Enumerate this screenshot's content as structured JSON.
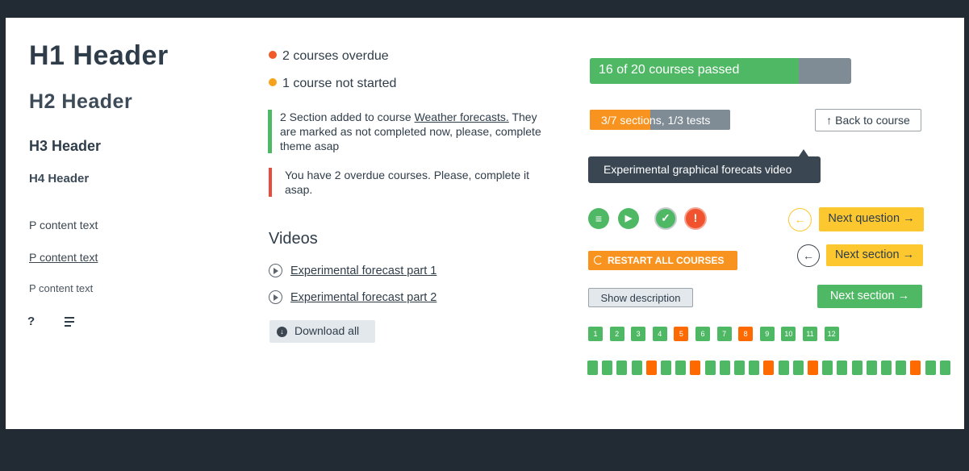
{
  "colors": {
    "green": "#4fb865",
    "orange": "#f7931e",
    "red_orange": "#ff6a00",
    "red": "#e94b3c",
    "yellow": "#fdc82f",
    "dark": "#3a4753",
    "gray": "#7f8c95"
  },
  "typography": {
    "h1": "H1 Header",
    "h2": "H2  Header",
    "h3": "H3  Header",
    "h4": "H4  Header",
    "p_plain": "P content text",
    "p_link": "P content text",
    "p_small": "P content text",
    "help_icon_glyph": "?",
    "icons": [
      "help-icon",
      "menu-icon"
    ]
  },
  "status": {
    "overdue": "2 courses overdue",
    "not_started": "1 course not started",
    "overdue_color": "#f15a29",
    "not_started_color": "#f7a21b"
  },
  "notices": [
    {
      "text_before": "2 Section added to course ",
      "link": "Weather forecasts.",
      "text_after": " They are marked as not completed now, please, complete theme asap",
      "color": "#4fb865"
    },
    {
      "text": "You have 2 overdue courses. Please, complete it asap.",
      "color": "#e94b3c"
    }
  ],
  "videos": {
    "title": "Videos",
    "items": [
      "Experimental forecast part 1",
      "Experimental forecast part 2"
    ],
    "download_label": "Download all"
  },
  "progress": {
    "courses_label": "16 of 20 courses passed",
    "courses_passed": 16,
    "courses_total": 20,
    "sections_label": "3/7 sections, 1/3 tests",
    "sections_done": 3,
    "sections_total": 7
  },
  "back_button": {
    "label": "Back to course",
    "icon": "arrow-up-icon"
  },
  "tooltip": {
    "text": "Experimental graphical forecats video"
  },
  "status_icons": [
    {
      "name": "list-icon",
      "glyph": "≡"
    },
    {
      "name": "play-icon",
      "glyph": "▶"
    },
    {
      "name": "check-icon",
      "glyph": "✓"
    },
    {
      "name": "alert-icon",
      "glyph": "!"
    }
  ],
  "buttons": {
    "next_question": "Next question",
    "next_section_yellow": "Next section",
    "next_section_green": "Next section",
    "restart_all": "RESTART ALL COURSES",
    "show_description": "Show description",
    "arrow_right_glyph": "➔",
    "arrow_left_glyph": "⮐"
  },
  "pages": {
    "numbers": [
      "1",
      "2",
      "3",
      "4",
      "5",
      "6",
      "7",
      "8",
      "9",
      "10",
      "11",
      "12"
    ],
    "states": [
      "done",
      "done",
      "done",
      "done",
      "overdue",
      "done",
      "done",
      "overdue",
      "done",
      "done",
      "done",
      "done"
    ]
  },
  "test_bars": {
    "states": [
      "done",
      "done",
      "done",
      "done",
      "overdue",
      "done",
      "done",
      "overdue",
      "done",
      "done",
      "done",
      "done",
      "overdue",
      "done",
      "done",
      "overdue",
      "done",
      "done",
      "done",
      "done",
      "done",
      "done",
      "overdue",
      "done",
      "done"
    ]
  }
}
